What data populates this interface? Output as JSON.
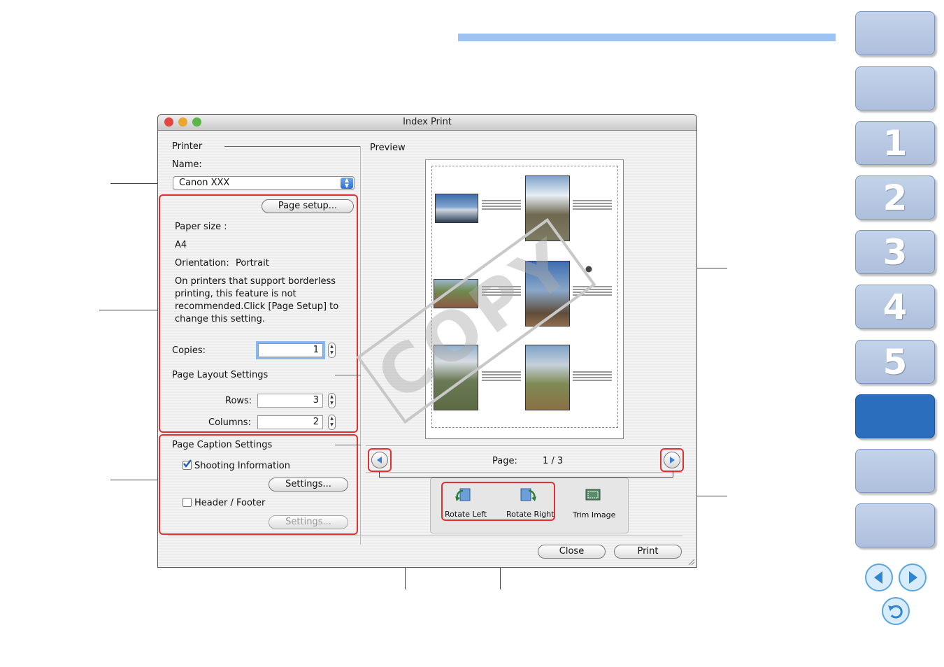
{
  "side_tabs": [
    {
      "label": ""
    },
    {
      "label": ""
    },
    {
      "label": "1"
    },
    {
      "label": "2"
    },
    {
      "label": "3"
    },
    {
      "label": "4"
    },
    {
      "label": "5"
    },
    {
      "label": ""
    },
    {
      "label": ""
    },
    {
      "label": ""
    }
  ],
  "colors": {
    "accent_bar": "#9dc3f2",
    "active_tab": "#2a6ebd",
    "highlight": "#e03030"
  },
  "window": {
    "title": "Index Print"
  },
  "printer": {
    "section_label": "Printer",
    "name_label": "Name:",
    "name_value": "Canon XXX",
    "page_setup_button": "Page setup...",
    "paper_size_label": "Paper size :",
    "paper_size_value": "A4",
    "orientation_label": "Orientation:",
    "orientation_value": "Portrait",
    "note": "On printers that support borderless printing, this feature is not recommended.Click [Page Setup] to change this setting."
  },
  "copies": {
    "label": "Copies:",
    "value": "1"
  },
  "layout": {
    "section_label": "Page Layout Settings",
    "rows_label": "Rows:",
    "rows_value": "3",
    "columns_label": "Columns:",
    "columns_value": "2"
  },
  "caption": {
    "section_label": "Page Caption Settings",
    "shooting_info_label": "Shooting Information",
    "shooting_info_checked": true,
    "settings_button": "Settings...",
    "header_footer_label": "Header / Footer",
    "header_footer_checked": false,
    "settings_button_disabled": "Settings..."
  },
  "preview": {
    "label": "Preview",
    "page_label": "Page:",
    "page_value": "1 / 3",
    "watermark": "COPY"
  },
  "tools": {
    "rotate_left": "Rotate Left",
    "rotate_right": "Rotate Right",
    "trim_image": "Trim Image"
  },
  "buttons": {
    "close": "Close",
    "print": "Print"
  }
}
